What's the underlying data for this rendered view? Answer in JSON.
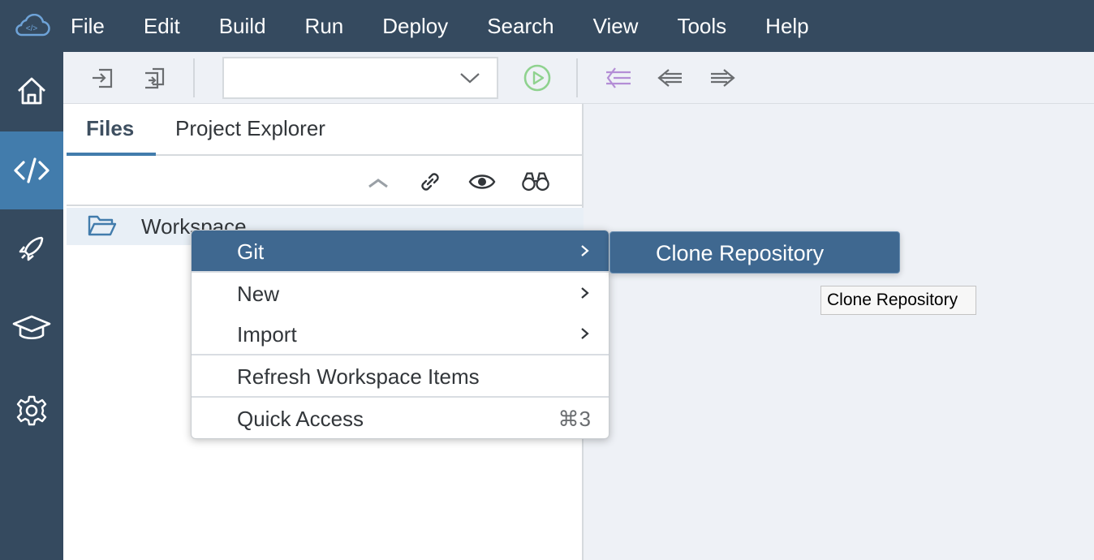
{
  "menubar": {
    "logo_icon": "cloud-code-icon",
    "items": [
      {
        "label": "File"
      },
      {
        "label": "Edit"
      },
      {
        "label": "Build"
      },
      {
        "label": "Run"
      },
      {
        "label": "Deploy"
      },
      {
        "label": "Search"
      },
      {
        "label": "View"
      },
      {
        "label": "Tools"
      },
      {
        "label": "Help"
      }
    ]
  },
  "sidebar": {
    "items": [
      {
        "icon": "home-icon"
      },
      {
        "icon": "code-icon",
        "active": true
      },
      {
        "icon": "rocket-icon"
      },
      {
        "icon": "graduation-cap-icon"
      },
      {
        "icon": "gear-icon"
      }
    ]
  },
  "toolbar": {
    "icons": [
      "import-icon",
      "export-icon",
      "run-icon",
      "collapse-compare-icon",
      "back-arrow-icon",
      "forward-arrow-icon"
    ],
    "select_value": ""
  },
  "panel": {
    "tabs": [
      {
        "label": "Files",
        "active": true
      },
      {
        "label": "Project Explorer",
        "active": false
      }
    ],
    "tools": [
      "collapse-all-icon",
      "link-icon",
      "eye-icon",
      "binoculars-icon"
    ],
    "tree": [
      {
        "label": "Workspace",
        "icon": "folder-open-icon"
      }
    ]
  },
  "context_menu": {
    "items": [
      {
        "label": "Git",
        "highlighted": true,
        "submenu": true
      },
      {
        "label": "New",
        "submenu": true
      },
      {
        "label": "Import",
        "submenu": true
      },
      {
        "label": "Refresh Workspace Items"
      },
      {
        "label": "Quick Access",
        "shortcut": "⌘3"
      }
    ]
  },
  "submenu": {
    "items": [
      {
        "label": "Clone Repository",
        "highlighted": true
      }
    ]
  },
  "tooltip": {
    "text": "Clone Repository"
  },
  "colors": {
    "shell": "#354a5f",
    "active": "#427cac",
    "highlight": "#3f6890",
    "run_green": "#8fd28f",
    "compare_purple": "#b48ed6"
  }
}
